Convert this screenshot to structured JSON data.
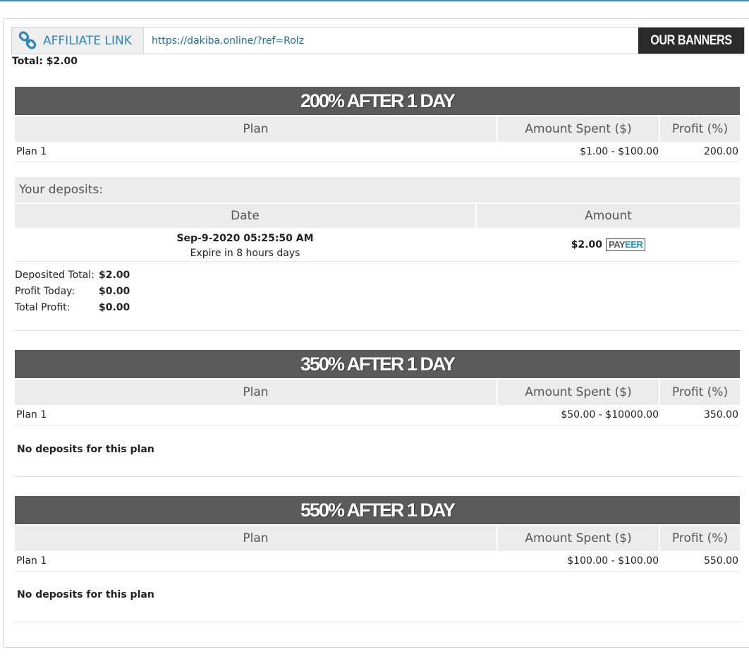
{
  "affiliate": {
    "label": "AFFILIATE LINK",
    "url": "https://dakiba.online/?ref=Rolz",
    "banners_button": "OUR BANNERS",
    "icon": "link-icon"
  },
  "total": "Total: $2.00",
  "colors": {
    "accent": "#2d86b8",
    "title_bar": "#5a5a5a",
    "header_bg": "#ececec"
  },
  "plans": [
    {
      "title": "200% AFTER 1 DAY",
      "headers": {
        "plan": "Plan",
        "amount": "Amount Spent ($)",
        "profit": "Profit (%)"
      },
      "rows": [
        {
          "plan": "Plan 1",
          "amount": "$1.00 - $100.00",
          "profit": "200.00"
        }
      ]
    },
    {
      "title": "350% AFTER 1 DAY",
      "headers": {
        "plan": "Plan",
        "amount": "Amount Spent ($)",
        "profit": "Profit (%)"
      },
      "rows": [
        {
          "plan": "Plan 1",
          "amount": "$50.00 - $10000.00",
          "profit": "350.00"
        }
      ],
      "no_deposits": "No deposits for this plan"
    },
    {
      "title": "550% AFTER 1 DAY",
      "headers": {
        "plan": "Plan",
        "amount": "Amount Spent ($)",
        "profit": "Profit (%)"
      },
      "rows": [
        {
          "plan": "Plan 1",
          "amount": "$100.00 - $100.00",
          "profit": "550.00"
        }
      ],
      "no_deposits": "No deposits for this plan"
    }
  ],
  "deposits": {
    "title": "Your deposits:",
    "headers": {
      "date": "Date",
      "amount": "Amount"
    },
    "rows": [
      {
        "date": "Sep-9-2020 05:25:50 AM",
        "expire": "Expire in 8 hours days",
        "amount": "$2.00",
        "method_a": "PAY",
        "method_b": "EER"
      }
    ],
    "stats": [
      {
        "label": "Deposited Total:",
        "value": "$2.00"
      },
      {
        "label": "Profit Today:",
        "value": "$0.00"
      },
      {
        "label": "Total Profit:",
        "value": "$0.00"
      }
    ]
  }
}
